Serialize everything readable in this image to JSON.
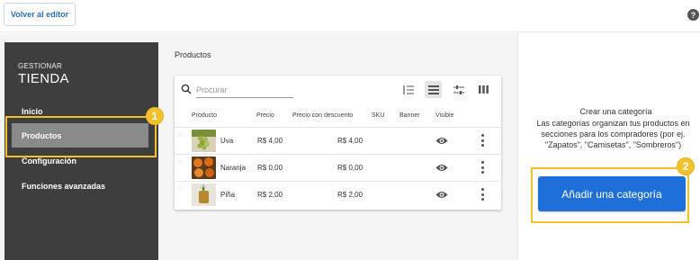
{
  "topbar": {
    "back_label": "Volver al editor",
    "help_icon": "question-circle-icon",
    "help_glyph": "?"
  },
  "sidebar": {
    "brand_small": "GESTIONAR",
    "brand_big": "TIENDA",
    "items": [
      {
        "label": "Inicio"
      },
      {
        "label": "Productos",
        "active": true
      },
      {
        "label": "Configuración"
      },
      {
        "label": "Funciones avanzadas"
      }
    ]
  },
  "annotations": {
    "badge1": "1",
    "badge2": "2",
    "highlight_color": "#f3c12c"
  },
  "main": {
    "section_title": "Productos",
    "search_placeholder": "Procurar",
    "toolbar_icons": [
      "list-numbered-icon",
      "list-view-icon",
      "filter-sliders-icon",
      "columns-icon"
    ],
    "columns": [
      "Producto",
      "Precio",
      "Precio con descuento",
      "SKU",
      "Banner",
      "Visible"
    ],
    "products": [
      {
        "name": "Uva",
        "price": "R$ 4,00",
        "discount_price": "R$ 4,00",
        "sku": "",
        "banner": "",
        "visible_icon": "eye-icon"
      },
      {
        "name": "Naranja",
        "price": "R$ 0,00",
        "discount_price": "R$ 0,00",
        "sku": "",
        "banner": "",
        "visible_icon": "eye-icon"
      },
      {
        "name": "Piña",
        "price": "R$ 2,00",
        "discount_price": "R$ 2,00",
        "sku": "",
        "banner": "",
        "visible_icon": "eye-icon"
      }
    ]
  },
  "right_panel": {
    "title": "Crear una categoría",
    "description": "Las categorías organizan tus productos en secciones para los compradores (por ej. \"Zapatos\", \"Camisetas\", \"Sombreros\")",
    "add_button": "Añadir una categoría"
  },
  "colors": {
    "accent": "#1e6fd9",
    "sidebar": "#3e3e3e",
    "highlight": "#f3c12c"
  }
}
